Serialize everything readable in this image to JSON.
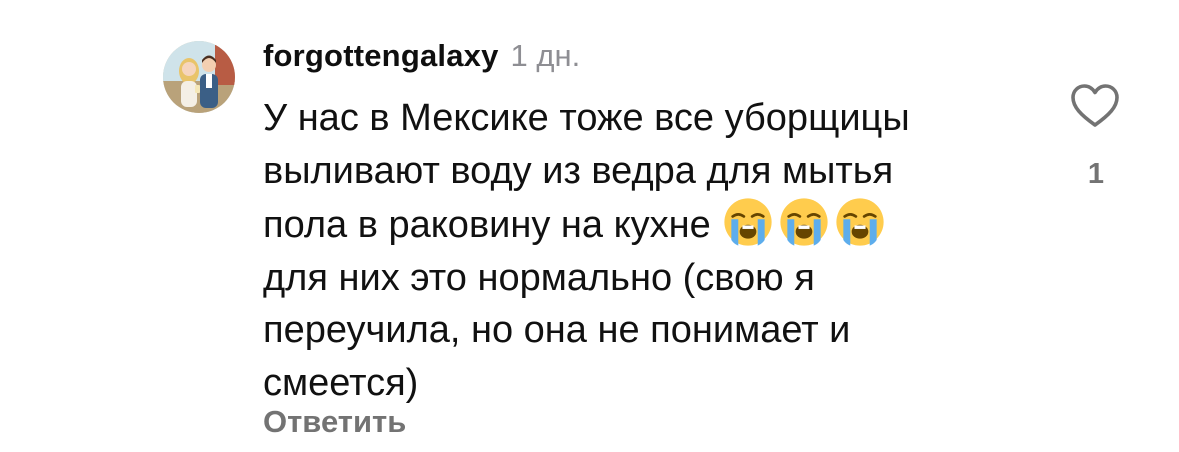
{
  "comment": {
    "username": "forgottengalaxy",
    "timestamp": "1 дн.",
    "text_lines": [
      "У нас в Мексике тоже все уборщицы",
      "выливают воду из ведра для мытья",
      "пола в раковину на кухне",
      "для них это нормально (свою я",
      "переучила, но она не понимает и",
      "смеется)"
    ],
    "emojis": [
      "loudly-crying-face",
      "loudly-crying-face",
      "loudly-crying-face"
    ],
    "reply_label": "Ответить",
    "like_count": "1",
    "like_icon": "heart-outline-icon"
  },
  "colors": {
    "text": "#111111",
    "secondary": "#8e8e93",
    "reply": "#737373",
    "emoji_face": "#ffcc4d",
    "emoji_tears": "#5dadec"
  }
}
